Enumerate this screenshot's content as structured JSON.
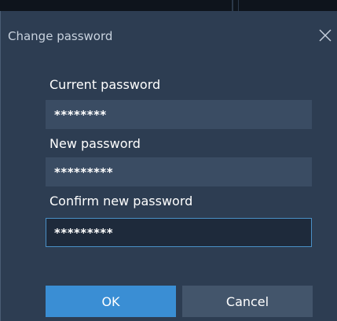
{
  "dialog": {
    "title": "Change password",
    "close_icon": "close-icon"
  },
  "form": {
    "current": {
      "label": "Current password",
      "value": "********"
    },
    "new": {
      "label": "New password",
      "value": "*********"
    },
    "confirm": {
      "label": "Confirm new password",
      "value": "*********"
    }
  },
  "buttons": {
    "ok_label": "OK",
    "cancel_label": "Cancel"
  },
  "colors": {
    "dialog_bg": "#2d3d52",
    "field_bg": "#3a4c63",
    "focused_field_bg": "#1e2a3b",
    "focus_border": "#4a90c6",
    "primary_button": "#3a8ed4",
    "secondary_button": "#43556b"
  }
}
